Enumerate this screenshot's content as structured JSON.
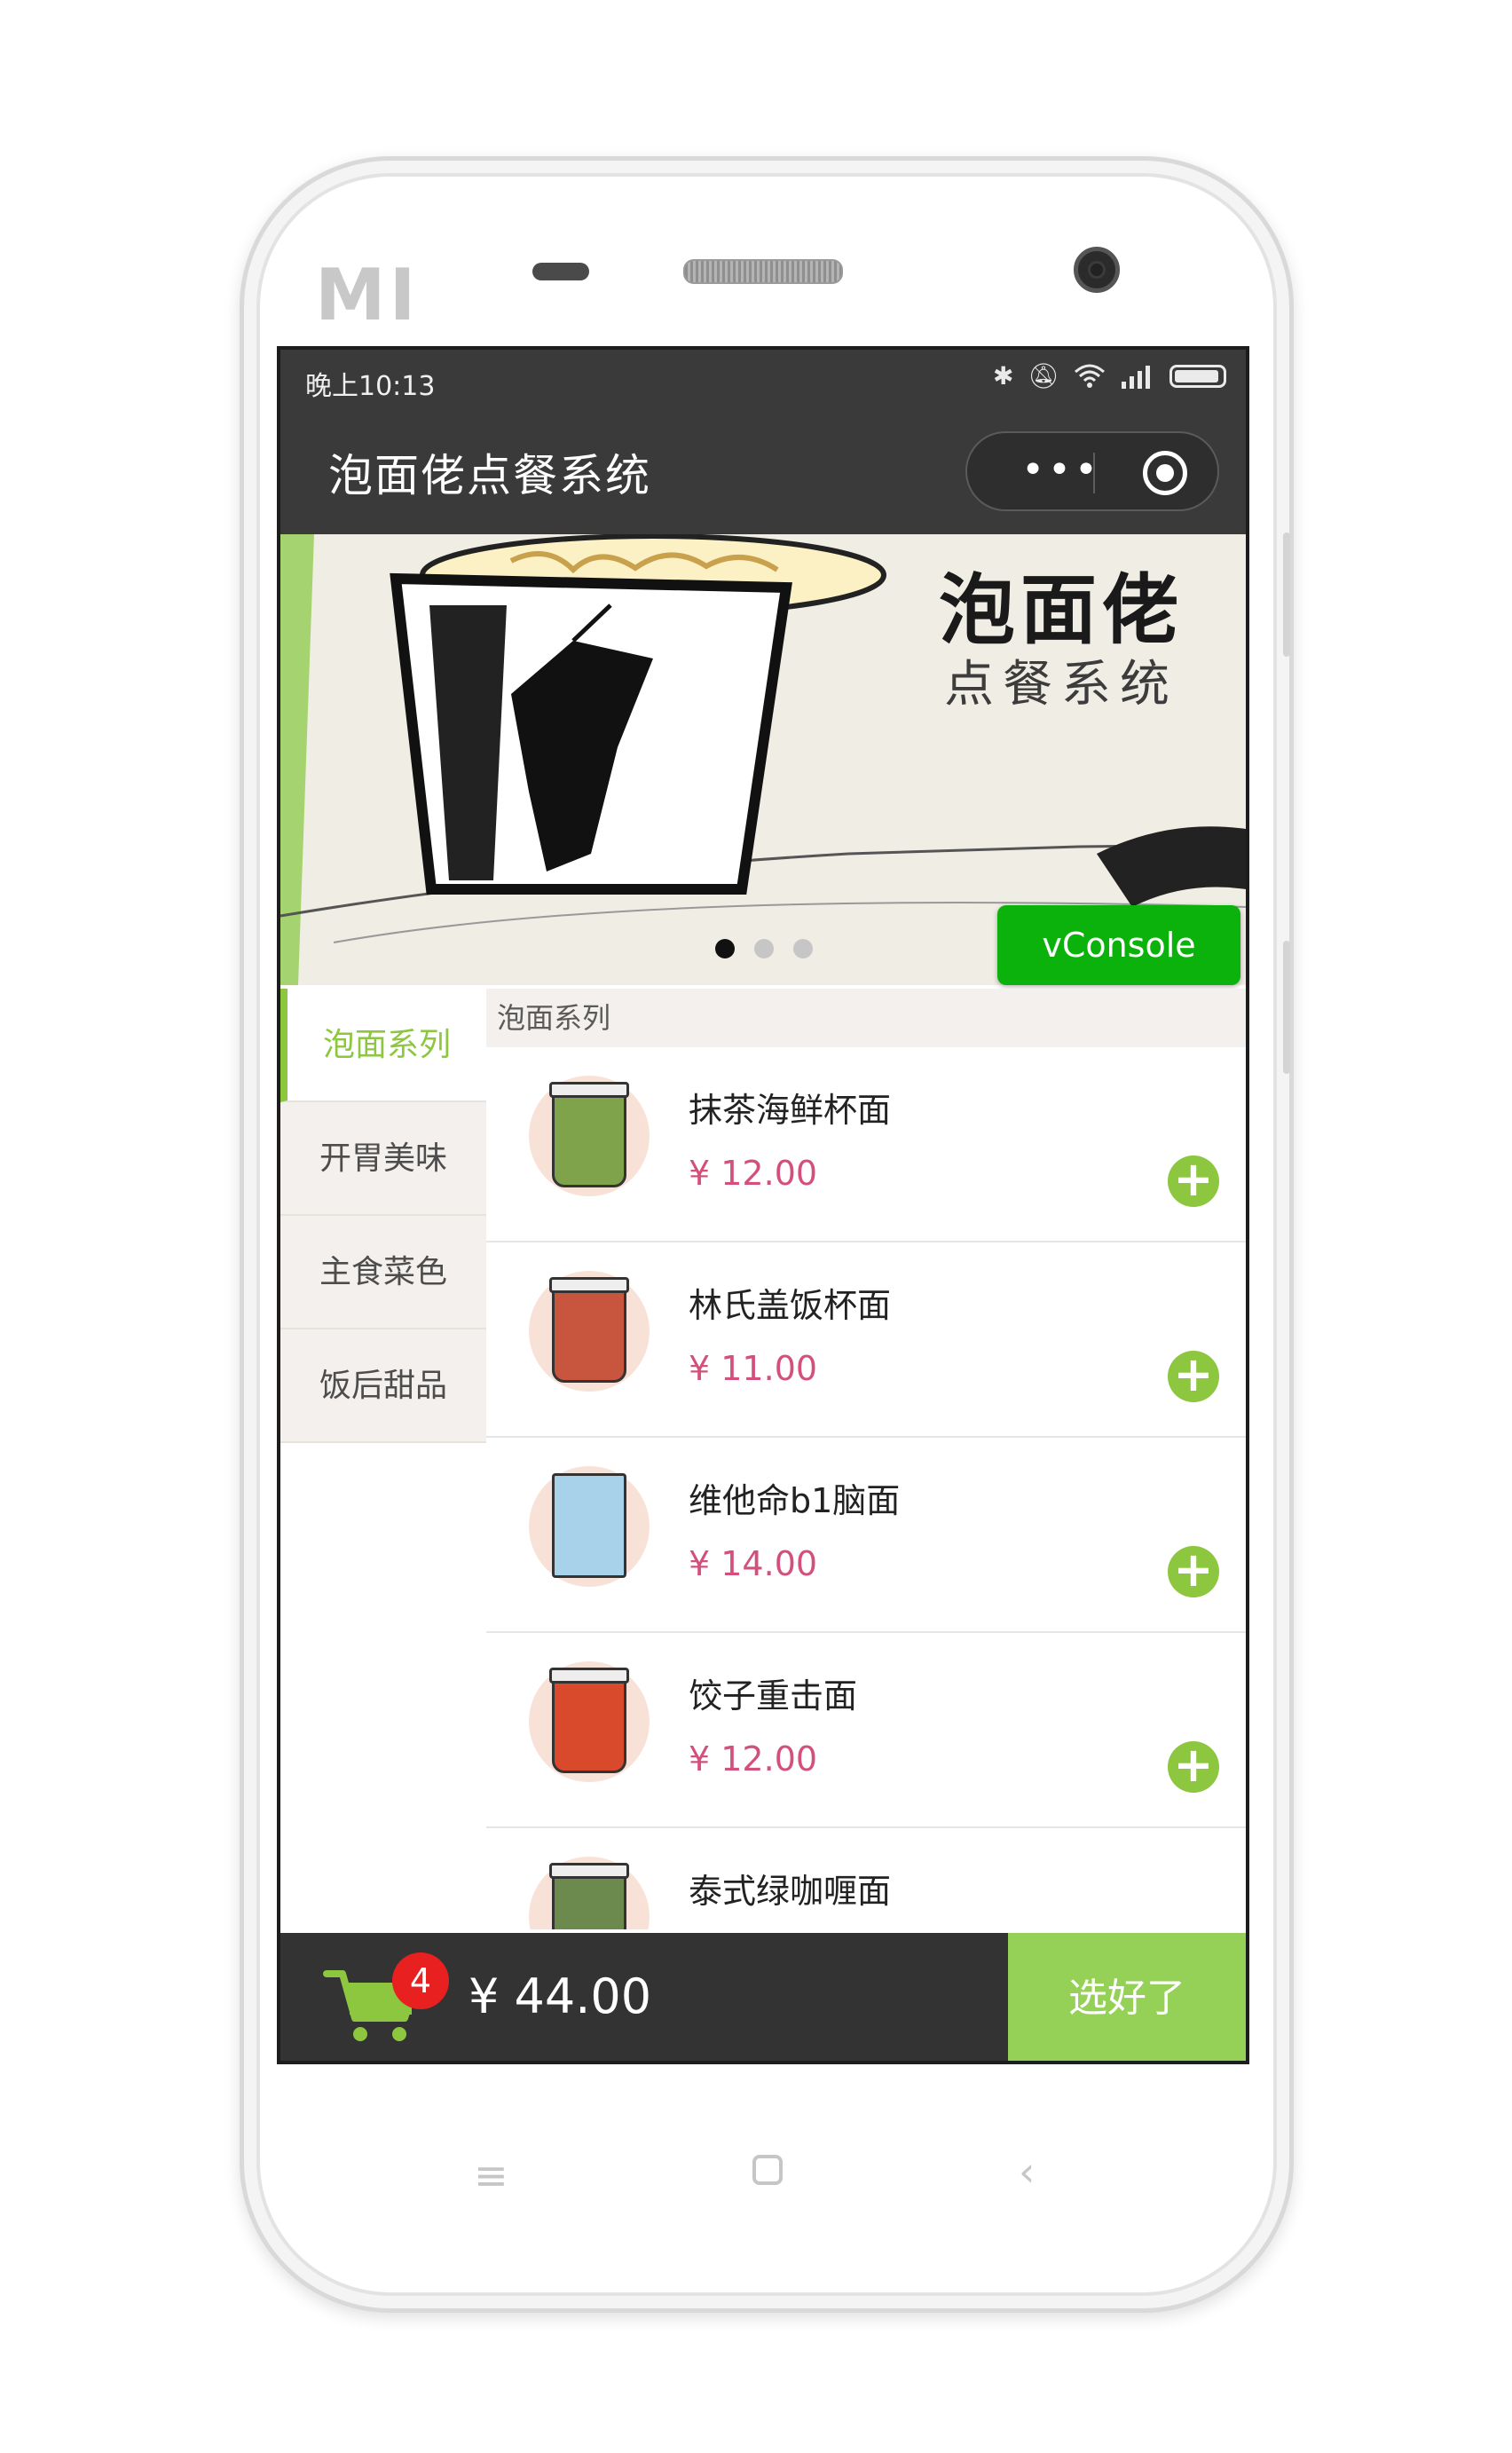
{
  "status_bar": {
    "time": "晚上10:13",
    "icons": [
      "bluetooth-icon",
      "mute-icon",
      "wifi-icon",
      "signal-icon",
      "battery-icon"
    ]
  },
  "nav": {
    "title": "泡面佬点餐系统",
    "more_label": "•••"
  },
  "banner": {
    "title_line1": "泡面佬",
    "title_line2": "点餐系统",
    "slide_count": 3,
    "active_slide": 1
  },
  "vconsole": {
    "label": "vConsole"
  },
  "categories": [
    {
      "label": "泡面系列",
      "active": true
    },
    {
      "label": "开胃美味",
      "active": false
    },
    {
      "label": "主食菜色",
      "active": false
    },
    {
      "label": "饭后甜品",
      "active": false
    }
  ],
  "section_header": "泡面系列",
  "products": [
    {
      "name": "抹茶海鲜杯面",
      "price": "¥ 12.00",
      "color": "#7fa34a"
    },
    {
      "name": "林氏盖饭杯面",
      "price": "¥ 11.00",
      "color": "#c8553d"
    },
    {
      "name": "维他命b1脑面",
      "price": "¥ 14.00",
      "color": "#a7d2ea"
    },
    {
      "name": "饺子重击面",
      "price": "¥ 12.00",
      "color": "#d94a2c"
    },
    {
      "name": "泰式绿咖喱面",
      "price": "",
      "color": "#6d8a4e"
    }
  ],
  "cart": {
    "count": "4",
    "total": "¥ 44.00",
    "confirm_label": "选好了"
  },
  "colors": {
    "accent_green": "#8dc63f",
    "price_pink": "#d2507a",
    "dark_bar": "#3a3a3a",
    "badge_red": "#e8201f"
  }
}
